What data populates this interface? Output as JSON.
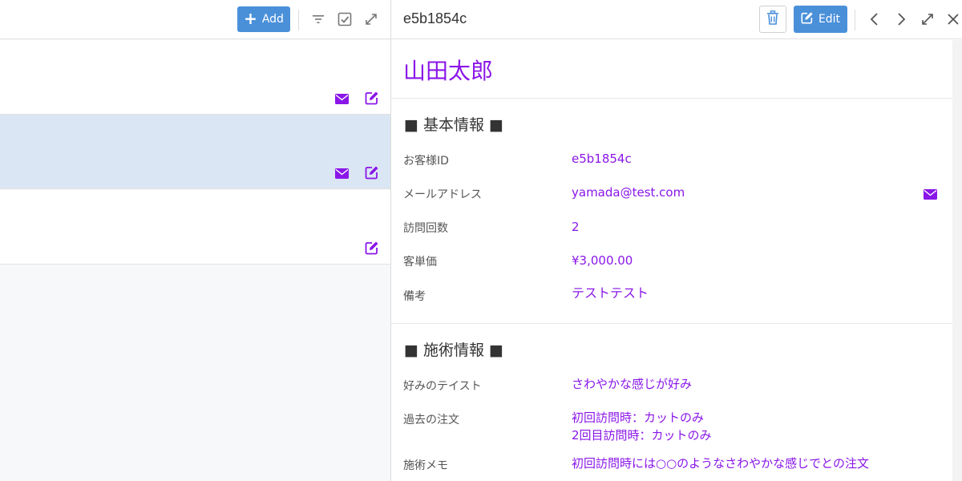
{
  "list_toolbar": {
    "add_label": "Add",
    "icons": [
      "filter-icon",
      "checkbox-icon",
      "expand-icon"
    ]
  },
  "list_rows": [
    {
      "selected": false,
      "icons": [
        "mail-icon",
        "edit-icon"
      ]
    },
    {
      "selected": true,
      "icons": [
        "mail-icon",
        "edit-icon"
      ]
    },
    {
      "selected": false,
      "icons": [
        "edit-icon"
      ]
    }
  ],
  "detail_toolbar": {
    "record_id": "e5b1854c",
    "edit_label": "Edit",
    "icons": [
      "trash-icon",
      "edit-icon",
      "chevron-left-icon",
      "chevron-right-icon",
      "expand-icon",
      "close-icon"
    ]
  },
  "detail": {
    "customer_name": "山田太郎",
    "basic_section": {
      "title": "■ 基本情報 ■",
      "fields": [
        {
          "label": "お客様ID",
          "value": "e5b1854c"
        },
        {
          "label": "メールアドレス",
          "value": "yamada@test.com"
        },
        {
          "label": "訪問回数",
          "value": "2"
        },
        {
          "label": "客単価",
          "value": "¥3,000.00"
        },
        {
          "label": "備考",
          "value": "テストテスト"
        }
      ]
    },
    "treatment_section": {
      "title": "■ 施術情報 ■",
      "fields": [
        {
          "label": "好みのテイスト",
          "value": "さわやかな感じが好み"
        },
        {
          "label": "過去の注文",
          "value_lines": [
            "初回訪問時：カットのみ",
            "2回目訪問時：カットのみ"
          ]
        },
        {
          "label": "施術メモ",
          "value": "初回訪問時には○○のようなさわやかな感じでとの注文"
        }
      ]
    }
  },
  "colors": {
    "accent": "#8a16e8",
    "button_blue": "#4a90d9",
    "selected_row": "#dae6f3"
  }
}
